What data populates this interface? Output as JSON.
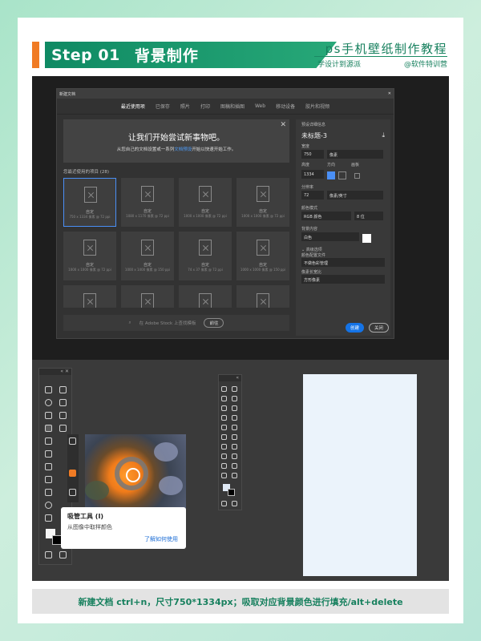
{
  "header": {
    "step": "Step 01",
    "title": "背景制作",
    "right_title": "ps手机壁纸制作教程",
    "sub_left": "学设计到源派",
    "sub_right": "@软件特训营"
  },
  "dialog": {
    "window_title": "新建文档",
    "close_glyph": "✕",
    "tabs": [
      "最近使用项",
      "已保存",
      "照片",
      "打印",
      "图稿和插图",
      "Web",
      "移动设备",
      "胶片和视频"
    ],
    "banner_title": "让我们开始尝试新事物吧。",
    "banner_sub_before": "从您自己的文档设置或一系列",
    "banner_sub_link": "文档预设",
    "banner_sub_after": "开始以快速开始工作。",
    "recent_label": "您最近使用的项目 (28)",
    "tiles": [
      {
        "name": "自定",
        "dims": "750 x 1334 像素 @ 72 ppi"
      },
      {
        "name": "自定",
        "dims": "1080 x 1170 像素 @ 72 ppi"
      },
      {
        "name": "自定",
        "dims": "1000 x 1000 像素 @ 72 ppi"
      },
      {
        "name": "自定",
        "dims": "1000 x 1000 像素 @ 72 ppi"
      },
      {
        "name": "自定",
        "dims": "1000 x 1000 像素 @ 72 ppi"
      },
      {
        "name": "自定",
        "dims": "1000 x 1400 像素 @ 150 ppi"
      },
      {
        "name": "自定",
        "dims": "74 x 37 像素 @ 72 ppi"
      },
      {
        "name": "自定",
        "dims": "1000 x 1000 像素 @ 150 ppi"
      },
      {
        "name": "",
        "dims": ""
      },
      {
        "name": "",
        "dims": ""
      },
      {
        "name": "",
        "dims": ""
      },
      {
        "name": "",
        "dims": ""
      }
    ],
    "search_placeholder": "在 Adobe Stock 上查找模板",
    "search_button": "前往",
    "side": {
      "section": "预设详细信息",
      "doc_name": "未标题-3",
      "width_label": "宽度",
      "width_value": "750",
      "width_unit": "像素",
      "height_label": "高度",
      "height_value": "1334",
      "orientation_label": "方向",
      "artboard_label": "画板",
      "resolution_label": "分辨率",
      "resolution_value": "72",
      "resolution_unit": "像素/英寸",
      "color_mode_label": "颜色模式",
      "color_mode_value": "RGB 颜色",
      "bit_depth": "8 位",
      "background_label": "背景内容",
      "background_value": "白色",
      "advanced_label": "高级选项",
      "profile_label": "颜色配置文件",
      "profile_value": "不做色彩管理",
      "pixel_ratio_label": "像素长宽比",
      "pixel_ratio_value": "方形像素"
    },
    "create_button": "创建",
    "close_button": "关闭"
  },
  "tooltip": {
    "title": "吸管工具 (I)",
    "desc": "从图像中取样颜色",
    "link": "了解如何使用"
  },
  "footer": {
    "text": "新建文档 ctrl+n，尺寸750*1334px；吸取对应背景颜色进行填充/alt+delete"
  },
  "colors": {
    "accent": "#f07b24",
    "brand_green": "#17805e",
    "canvas_fill": "#ebf3fb",
    "ps_blue": "#1473e6"
  }
}
